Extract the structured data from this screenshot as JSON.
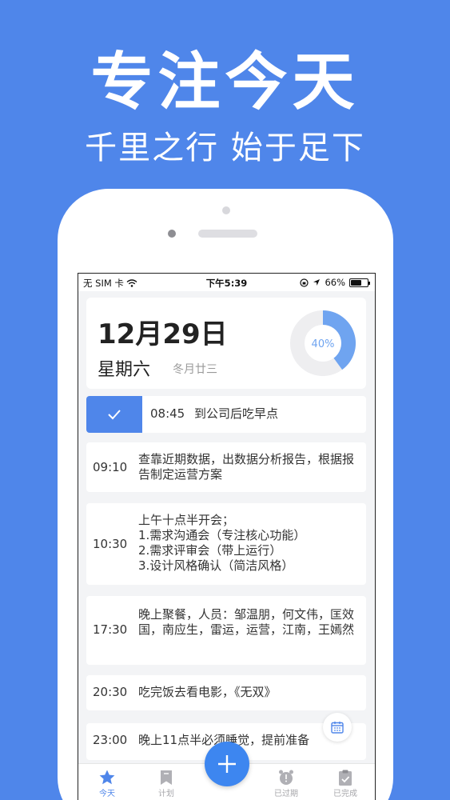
{
  "promo": {
    "headline": "专注今天",
    "subline": "千里之行 始于足下"
  },
  "status_bar": {
    "carrier": "无 SIM 卡",
    "time": "下午5:39",
    "battery": "66%",
    "battery_level": 0.66
  },
  "date_card": {
    "date": "12月29日",
    "weekday": "星期六",
    "lunar": "冬月廿三",
    "progress_label": "40%",
    "progress_value": 0.4
  },
  "tasks": [
    {
      "time": "08:45",
      "text": "到公司后吃早点",
      "done": true
    },
    {
      "time": "09:10",
      "text": "查靠近期数据，出数据分析报告，根据报告制定运营方案"
    },
    {
      "time": "10:30",
      "lines": [
        "上午十点半开会；",
        "1.需求沟通会（专注核心功能）",
        "2.需求评审会（带上运行）",
        "3.设计风格确认（简洁风格）"
      ]
    },
    {
      "time": "17:30",
      "text": "晚上聚餐，人员：邹温朋，何文伟，匡效国，南应生，雷运，运营，江南，王嫣然"
    },
    {
      "time": "20:30",
      "text": "吃完饭去看电影，《无双》"
    },
    {
      "time": "23:00",
      "text": "晚上11点半必须睡觉，提前准备"
    }
  ],
  "tabs": [
    {
      "label": "今天",
      "icon": "star-icon",
      "active": true
    },
    {
      "label": "计划",
      "icon": "bookmark-icon"
    },
    {
      "label": "已过期",
      "icon": "alarm-clock-icon"
    },
    {
      "label": "已完成",
      "icon": "clipboard-check-icon"
    }
  ],
  "colors": {
    "accent": "#4f86ea",
    "fab": "#3d86f0",
    "donut_fill": "#6fa4f0",
    "donut_track": "#eeeef0"
  }
}
